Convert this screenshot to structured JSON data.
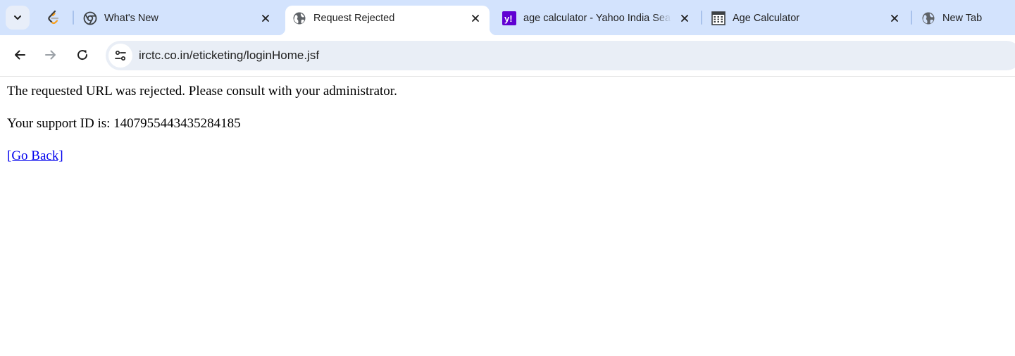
{
  "tabs": [
    {
      "title": "What's New",
      "favicon": "chrome-icon",
      "active": false
    },
    {
      "title": "Request Rejected",
      "favicon": "globe-icon",
      "active": true
    },
    {
      "title": "age calculator - Yahoo India Sea",
      "favicon": "yahoo-icon",
      "active": false
    },
    {
      "title": "Age Calculator",
      "favicon": "calculator-icon",
      "active": false
    },
    {
      "title": "New Tab",
      "favicon": "globe-icon",
      "active": false
    }
  ],
  "pinned_tab": {
    "favicon": "leetcode-icon"
  },
  "toolbar": {
    "back_icon": "arrow-left-icon",
    "forward_icon": "arrow-right-icon",
    "reload_icon": "reload-icon",
    "site_info_icon": "tune-icon",
    "url": "irctc.co.in/eticketing/loginHome.jsf"
  },
  "page": {
    "message": "The requested URL was rejected. Please consult with your administrator.",
    "support_id_text": "Your support ID is: 1407955443435284185",
    "go_back_link": "[Go Back]"
  },
  "colors": {
    "tabstrip_bg": "#d3e3fd",
    "omnibox_bg": "#e9eef6",
    "link": "#0000ee",
    "yahoo_purple": "#6001d2"
  }
}
